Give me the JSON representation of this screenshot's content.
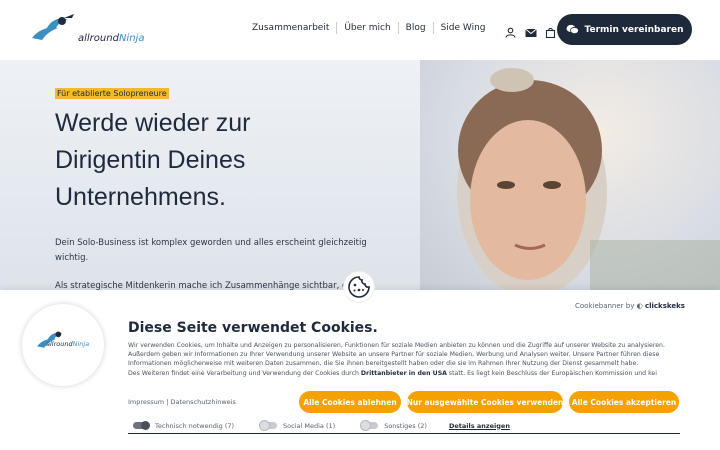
{
  "brand": {
    "logo_prefix": "allround",
    "logo_suffix": "Ninja"
  },
  "nav": {
    "items": [
      "Zusammenarbeit",
      "Über mich",
      "Blog",
      "Side Wing"
    ]
  },
  "header_icons": [
    "user-icon",
    "mail-icon",
    "cart-icon"
  ],
  "cta": {
    "label": "Termin vereinbaren",
    "icon": "chat-bubbles-icon"
  },
  "hero": {
    "tag": "Für etablierte Solopreneure",
    "headline": "Werde wieder zur Dirigentin Deines Unternehmens.",
    "para1": "Dein Solo-Business ist komplex geworden und alles erscheint gleichzeitig wichtig.",
    "para2": "Als strategische Mitdenkerin mache ich Zusammenhänge sichtbar, da"
  },
  "cookie": {
    "powered_by_prefix": "Cookiebanner by",
    "powered_by_brand": "clickskeks",
    "title": "Diese Seite verwendet Cookies.",
    "text_1": "Wir verwenden Cookies, um Inhalte und Anzeigen zu personalisieren, Funktionen für soziale Medien anbieten zu können und die Zugriffe auf unserer Website zu analysieren. Außerdem geben wir Informationen zu Ihrer Verwendung unserer Website an unsere Partner für soziale Medien, Werbung und Analysen weiter. Unsere Partner führen diese Informationen möglicherweise mit weiteren Daten zusammen, die Sie ihnen bereitgestellt haben oder die sie im Rahmen Ihrer Nutzung der Dienst gesammelt habe.",
    "text_2_prefix": "Des Weiteren findet eine Verarbeitung und Verwendung der Cookies durch",
    "text_2_link": "Drittanbieter in den USA",
    "text_2_suffix": "statt. Es liegt kein Beschluss der Europäischen Kommission und kei",
    "link_impressum": "Impressum",
    "link_sep": "|",
    "link_datenschutz": "Datenschutzhinweis",
    "btn_decline": "Alle Cookies ablehnen",
    "btn_selected": "Nur ausgewählte Cookies verwenden",
    "btn_accept": "Alle Cookies akzeptieren",
    "toggle_necessary": "Technisch notwendig (7)",
    "toggle_social": "Social Media (1)",
    "toggle_other": "Sonstiges (2)",
    "details": "Details anzeigen"
  },
  "colors": {
    "accent": "#f5a200",
    "dark": "#1e2a3a",
    "highlight": "#f3b928"
  }
}
